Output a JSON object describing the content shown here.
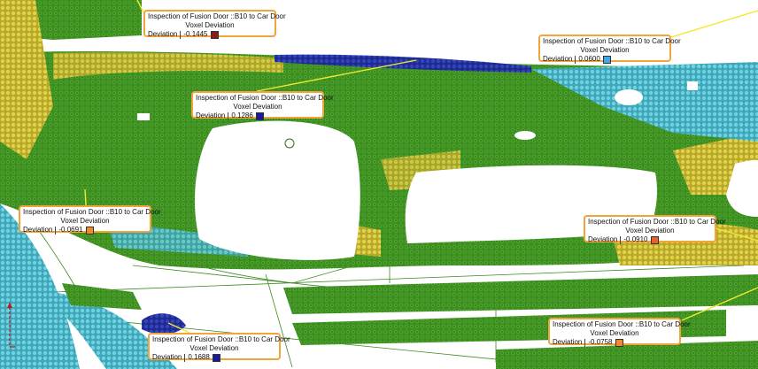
{
  "callouts": [
    {
      "title": "Inspection of Fusion Door ::B10 to Car Door",
      "subtitle": "Voxel Deviation",
      "label": "Deviation",
      "value": "-0.1445",
      "color": "#8b1a1a"
    },
    {
      "title": "Inspection of Fusion Door ::B10 to Car Door",
      "subtitle": "Voxel Deviation",
      "label": "Deviation",
      "value": "0.0600",
      "color": "#3ea8e8"
    },
    {
      "title": "Inspection of Fusion Door ::B10 to Car Door",
      "subtitle": "Voxel Deviation",
      "label": "Deviation",
      "value": "0.1286",
      "color": "#1a1a9c"
    },
    {
      "title": "Inspection of Fusion Door ::B10 to Car Door",
      "subtitle": "Voxel Deviation",
      "label": "Deviation",
      "value": "-0.0691",
      "color": "#f08a2a"
    },
    {
      "title": "Inspection of Fusion Door ::B10 to Car Door",
      "subtitle": "Voxel Deviation",
      "label": "Deviation",
      "value": "-0.0910",
      "color": "#e8602a"
    },
    {
      "title": "Inspection of Fusion Door ::B10 to Car Door",
      "subtitle": "Voxel Deviation",
      "label": "Deviation",
      "value": "-0.0758",
      "color": "#f08a2a"
    },
    {
      "title": "Inspection of Fusion Door ::B10 to Car Door",
      "subtitle": "Voxel Deviation",
      "label": "Deviation",
      "value": "0.1688",
      "color": "#1a1a9c"
    }
  ],
  "colors": {
    "green": "#3a8a1e",
    "yellow": "#d8c83a",
    "cyan": "#5fc8d8",
    "blue": "#2a3aa8",
    "leader": "#f2e830",
    "callout_border": "#f2a33a"
  }
}
